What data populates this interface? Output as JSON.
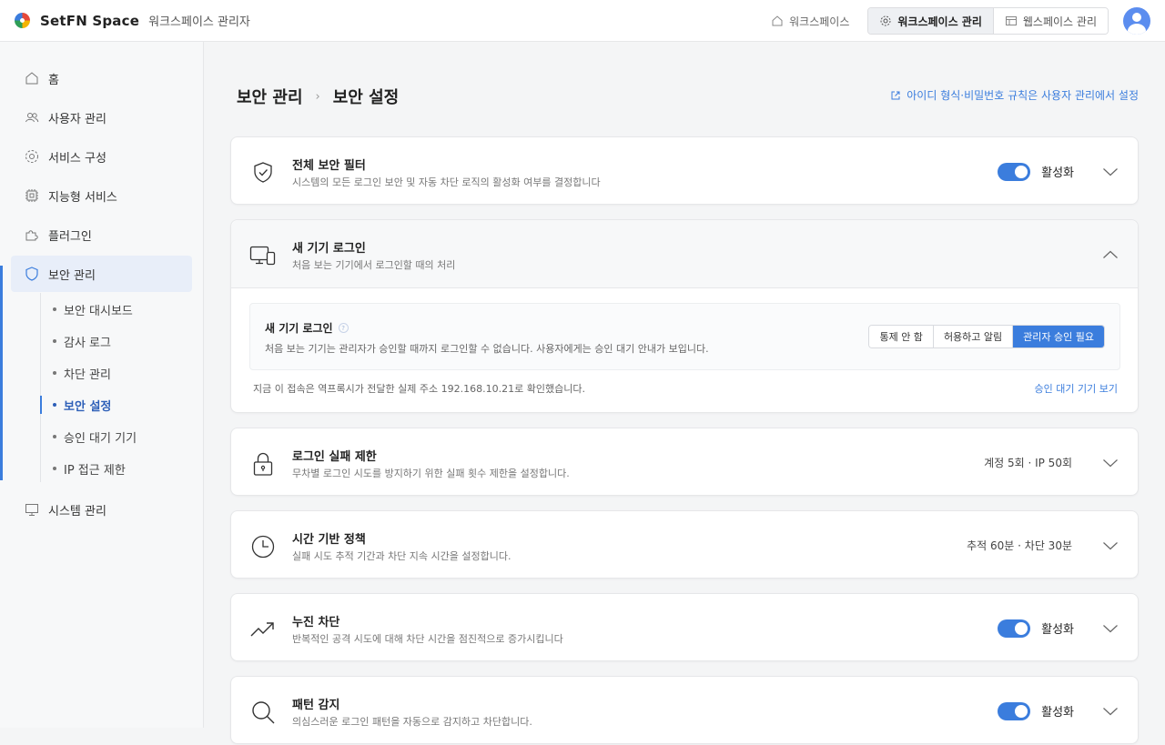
{
  "header": {
    "brand": "SetFN Space",
    "subtitle": "워크스페이스 관리자",
    "workspace_link": "워크스페이스",
    "seg_admin": "워크스페이스 관리",
    "seg_web": "웹스페이스 관리"
  },
  "sidebar": {
    "items": [
      {
        "label": "홈",
        "icon": "home-icon"
      },
      {
        "label": "사용자 관리",
        "icon": "users-icon"
      },
      {
        "label": "서비스 구성",
        "icon": "gear-icon"
      },
      {
        "label": "지능형 서비스",
        "icon": "chip-icon"
      },
      {
        "label": "플러그인",
        "icon": "puzzle-icon"
      },
      {
        "label": "보안 관리",
        "icon": "shield-icon"
      },
      {
        "label": "시스템 관리",
        "icon": "monitor-icon"
      }
    ],
    "sub_items": [
      "보안 대시보드",
      "감사 로그",
      "차단 관리",
      "보안 설정",
      "승인 대기 기기",
      "IP 접근 제한"
    ]
  },
  "page": {
    "breadcrumb_parent": "보안 관리",
    "breadcrumb_current": "보안 설정",
    "rules_link": "아이디 형식·비밀번호 규칙은 사용자 관리에서 설정"
  },
  "cards": {
    "filter": {
      "title": "전체 보안 필터",
      "desc": "시스템의 모든 로그인 보안 및 자동 차단 로직의 활성화 여부를 결정합니다",
      "state": "활성화"
    },
    "newdevice": {
      "title": "새 기기 로그인",
      "desc": "처음 보는 기기에서 로그인할 때의 처리",
      "inner_title": "새 기기 로그인",
      "inner_desc": "처음 보는 기기는 관리자가 승인할 때까지 로그인할 수 없습니다. 사용자에게는 승인 대기 안내가 보입니다.",
      "options": [
        "통제 안 함",
        "허용하고 알림",
        "관리자 승인 필요"
      ],
      "selected": "관리자 승인 필요",
      "note": "지금 이 접속은 역프록시가 전달한 실제 주소 192.168.10.21로 확인했습니다.",
      "note_link": "승인 대기 기기 보기"
    },
    "fail": {
      "title": "로그인 실패 제한",
      "desc": "무차별 로그인 시도를 방지하기 위한 실패 횟수 제한을 설정합니다.",
      "summary": "계정 5회 · IP 50회"
    },
    "time": {
      "title": "시간 기반 정책",
      "desc": "실패 시도 추적 기간과 차단 지속 시간을 설정합니다.",
      "summary": "추적 60분 · 차단 30분"
    },
    "progressive": {
      "title": "누진 차단",
      "desc": "반복적인 공격 시도에 대해 차단 시간을 점진적으로 증가시킵니다",
      "state": "활성화"
    },
    "pattern": {
      "title": "패턴 감지",
      "desc": "의심스러운 로그인 패턴을 자동으로 감지하고 차단합니다.",
      "state": "활성화"
    }
  },
  "colors": {
    "accent": "#3b7ddd",
    "active_bg": "#e8eef9"
  }
}
